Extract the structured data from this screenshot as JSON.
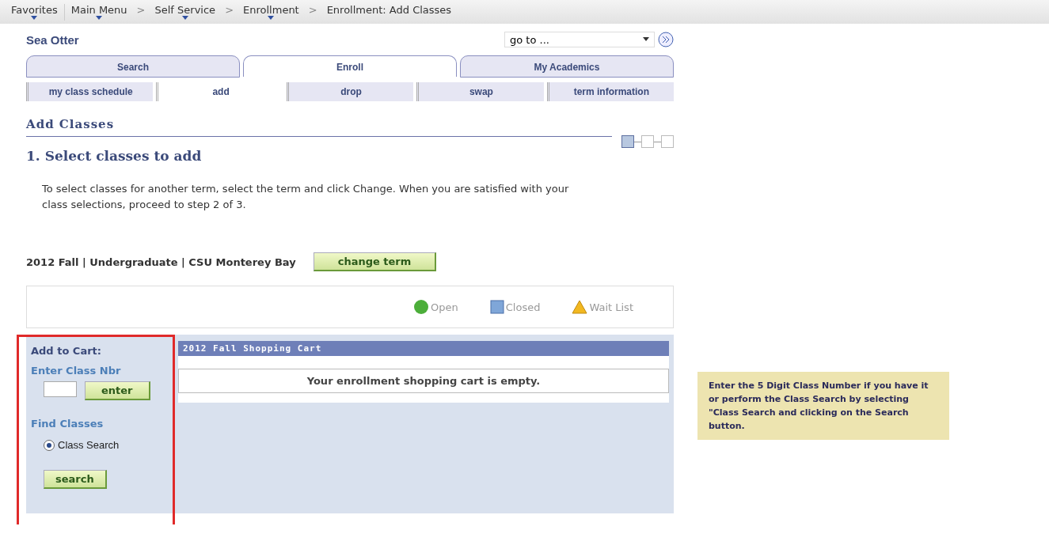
{
  "breadcrumbs": [
    {
      "label": "Favorites",
      "menu": true
    },
    {
      "label": "Main Menu",
      "menu": true
    },
    {
      "label": "Self Service",
      "menu": true
    },
    {
      "label": "Enrollment",
      "menu": true
    },
    {
      "label": "Enrollment: Add Classes",
      "menu": false
    }
  ],
  "separator": ">",
  "site_title": "Sea Otter",
  "goto": {
    "value": "go to ..."
  },
  "tabs": [
    {
      "label": "Search",
      "selected": false
    },
    {
      "label": "Enroll",
      "selected": true
    },
    {
      "label": "My Academics",
      "selected": false
    }
  ],
  "subtabs": [
    {
      "label": "my class schedule",
      "selected": false
    },
    {
      "label": "add",
      "selected": true
    },
    {
      "label": "drop",
      "selected": false
    },
    {
      "label": "swap",
      "selected": false
    },
    {
      "label": "term information",
      "selected": false
    }
  ],
  "page_title": "Add Classes",
  "steps": [
    {
      "selected": true
    },
    {
      "selected": false
    },
    {
      "selected": false
    }
  ],
  "step_heading": "1.  Select classes to add",
  "instructions": "To select classes for another term, select the term and click Change.  When you are satisfied with your class selections, proceed to step 2 of 3.",
  "term": "2012 Fall | Undergraduate | CSU Monterey Bay",
  "change_term_button": "change term",
  "legend": [
    {
      "kind": "circle",
      "label": "Open",
      "color": "#4cae3a"
    },
    {
      "kind": "square",
      "label": "Closed",
      "color": "#7fa6d8"
    },
    {
      "kind": "triangle",
      "label": "Wait List",
      "color": "#f2b820"
    }
  ],
  "add_to_cart": {
    "title": "Add to Cart:",
    "class_nbr_label": "Enter Class Nbr",
    "enter_button": "enter",
    "find_label": "Find Classes",
    "options": [
      {
        "label": "Class Search",
        "selected": true
      }
    ],
    "search_button": "search"
  },
  "cart": {
    "title": "2012 Fall Shopping Cart",
    "message": "Your enrollment shopping cart is empty."
  },
  "callout": "Enter the 5 Digit Class Number if you have it or perform the Class Search by selecting \"Class Search and clicking on the Search button."
}
